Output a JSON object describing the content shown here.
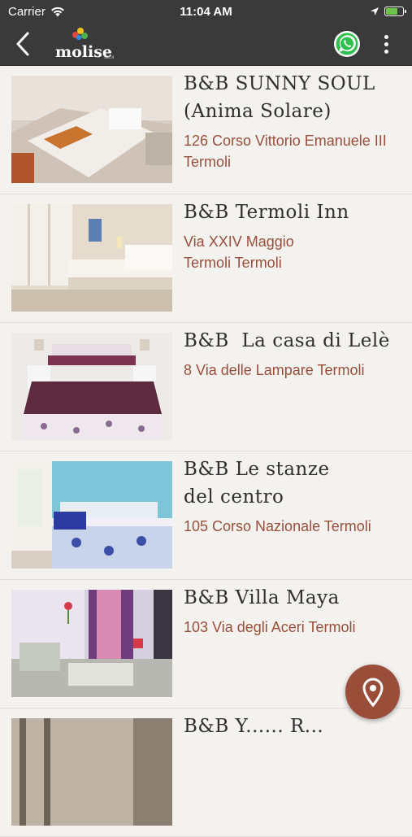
{
  "status_bar": {
    "carrier": "Carrier",
    "time": "11:04 AM"
  },
  "nav": {
    "logo_text": "molise",
    "logo_sub": "sito.it",
    "back_icon": "chevron-left-icon",
    "whatsapp_icon": "whatsapp-icon",
    "more_icon": "more-vertical-icon"
  },
  "listings": [
    {
      "title": "B&B SUNNY SOUL\n(Anima Solare)",
      "address": "126 Corso Vittorio Emanuele III Termoli"
    },
    {
      "title": "B&B Termoli Inn",
      "address": "Via XXIV Maggio\nTermoli Termoli"
    },
    {
      "title": "B&B  La casa di Lelè",
      "address": "8 Via delle Lampare Termoli"
    },
    {
      "title": "B&B Le stanze\ndel centro",
      "address": "105 Corso Nazionale Termoli"
    },
    {
      "title": "B&B Villa Maya",
      "address": "103 Via degli Aceri Termoli"
    },
    {
      "title": "B&B Y...... R...",
      "address": ""
    }
  ],
  "fab": {
    "icon": "map-pin-icon"
  },
  "colors": {
    "bar": "#3a3a3a",
    "accent": "#9a4e3a",
    "background": "#f4f2ef"
  }
}
